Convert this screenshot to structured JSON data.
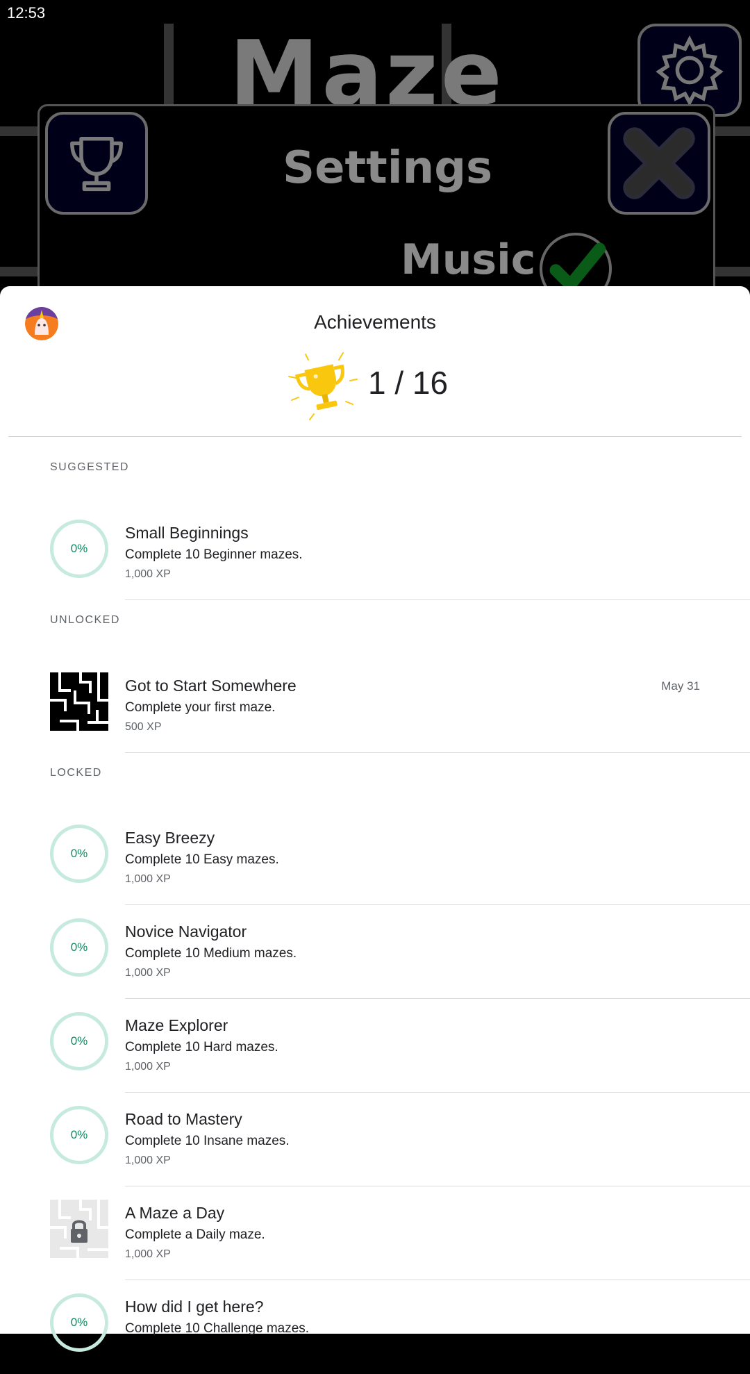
{
  "status_bar": {
    "time": "12:53"
  },
  "background": {
    "title": "Maze",
    "settings_title": "Settings",
    "music_label": "Music"
  },
  "sheet": {
    "title": "Achievements",
    "count": "1 / 16",
    "sections": {
      "suggested": "SUGGESTED",
      "unlocked": "UNLOCKED",
      "locked": "LOCKED"
    },
    "suggested": [
      {
        "name": "Small Beginnings",
        "desc": "Complete 10 Beginner mazes.",
        "xp": "1,000 XP",
        "progress": "0%"
      }
    ],
    "unlocked": [
      {
        "name": "Got to Start Somewhere",
        "desc": "Complete your first maze.",
        "xp": "500 XP",
        "date": "May 31"
      }
    ],
    "locked": [
      {
        "name": "Easy Breezy",
        "desc": "Complete 10 Easy mazes.",
        "xp": "1,000 XP",
        "progress": "0%"
      },
      {
        "name": "Novice Navigator",
        "desc": "Complete 10 Medium mazes.",
        "xp": "1,000 XP",
        "progress": "0%"
      },
      {
        "name": "Maze Explorer",
        "desc": "Complete 10 Hard mazes.",
        "xp": "1,000 XP",
        "progress": "0%"
      },
      {
        "name": "Road to Mastery",
        "desc": "Complete 10 Insane mazes.",
        "xp": "1,000 XP",
        "progress": "0%"
      },
      {
        "name": "A Maze a Day",
        "desc": "Complete a Daily maze.",
        "xp": "1,000 XP"
      },
      {
        "name": "How did I get here?",
        "desc": "Complete 10 Challenge mazes.",
        "progress": "0%"
      }
    ]
  },
  "colors": {
    "ring": "#c6eae0",
    "ring_text": "#0b8a5f",
    "trophy": "#f9c80e"
  }
}
